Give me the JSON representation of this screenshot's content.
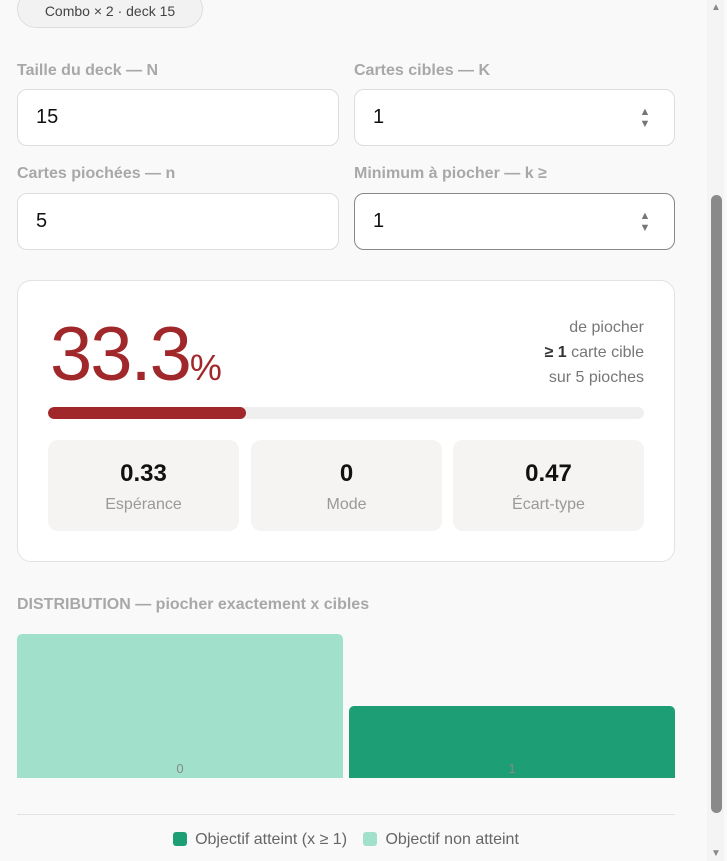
{
  "chip": "Combo × 2 · deck 15",
  "fields": [
    {
      "label": "Taille du deck — N",
      "value": "15"
    },
    {
      "label": "Cartes cibles — K",
      "value": "1"
    },
    {
      "label": "Cartes piochées — n",
      "value": "5"
    },
    {
      "label": "Minimum à piocher — k ≥",
      "value": "1"
    }
  ],
  "result": {
    "value": "33.3",
    "unit": "%",
    "line1": "de piocher",
    "line2_bold": "≥ 1",
    "line2": " carte cible",
    "line3": "sur 5 pioches",
    "progress": 0.333,
    "color": "#a0282b"
  },
  "stats": [
    {
      "value": "0.33",
      "label": "Espérance"
    },
    {
      "value": "0",
      "label": "Mode"
    },
    {
      "value": "0.47",
      "label": "Écart-type"
    }
  ],
  "chart_data": {
    "type": "bar",
    "title": "DISTRIBUTION — piocher exactement x cibles",
    "categories": [
      "0",
      "1"
    ],
    "values": [
      0.667,
      0.333
    ],
    "colors": [
      "#a1e1cb",
      "#1e9e74"
    ],
    "ylim": [
      0,
      0.667
    ],
    "legend": [
      {
        "label": "Objectif atteint (x ≥ 1)",
        "color": "#1e9e74"
      },
      {
        "label": "Objectif non atteint",
        "color": "#a1e1cb"
      }
    ]
  }
}
